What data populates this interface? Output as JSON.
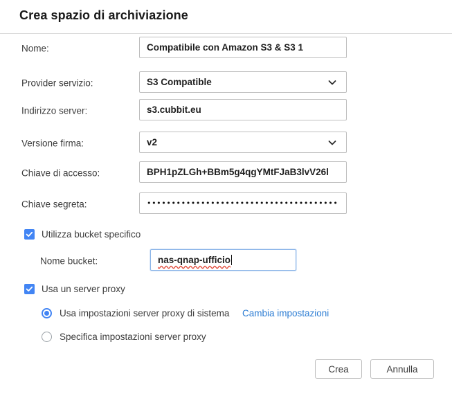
{
  "dialog": {
    "title": "Crea spazio di archiviazione"
  },
  "form": {
    "fields": [
      {
        "label": "Nome:",
        "value": "Compatibile con Amazon S3 & S3 1",
        "type": "text",
        "name": "nome"
      },
      {
        "label": "Provider servizio:",
        "value": "S3 Compatible",
        "type": "select",
        "name": "provider-servizio"
      },
      {
        "label": "Indirizzo server:",
        "value": "s3.cubbit.eu",
        "type": "text",
        "name": "indirizzo-server"
      },
      {
        "label": "Versione firma:",
        "value": "v2",
        "type": "select",
        "name": "versione-firma"
      },
      {
        "label": "Chiave di accesso:",
        "value": "BPH1pZLGh+BBm5g4qgYMtFJaB3lvV26l",
        "type": "text",
        "name": "chiave-accesso"
      },
      {
        "label": "Chiave segreta:",
        "value": "••••••••••••••••••••••••••••••••••••••••••••••",
        "type": "password",
        "name": "chiave-segreta"
      }
    ]
  },
  "bucket": {
    "checkbox_label": "Utilizza bucket specifico",
    "checkbox_checked": true,
    "name_label": "Nome bucket:",
    "name_value": "nas-qnap-ufficio"
  },
  "proxy": {
    "checkbox_label": "Usa un server proxy",
    "checkbox_checked": true,
    "options": [
      {
        "label": "Usa impostazioni server proxy di sistema",
        "selected": true,
        "link": "Cambia impostazioni"
      },
      {
        "label": "Specifica impostazioni server proxy",
        "selected": false
      }
    ]
  },
  "buttons": {
    "create": "Crea",
    "cancel": "Annulla"
  },
  "icons": {
    "chevron_down": "chevron-down-icon",
    "checkmark": "checkmark-icon"
  },
  "colors": {
    "accent": "#4285f4",
    "link": "#2b7cd3",
    "border": "#bdbdbd",
    "focus_border": "#8ab4e8",
    "spellcheck": "#e24a3a"
  }
}
